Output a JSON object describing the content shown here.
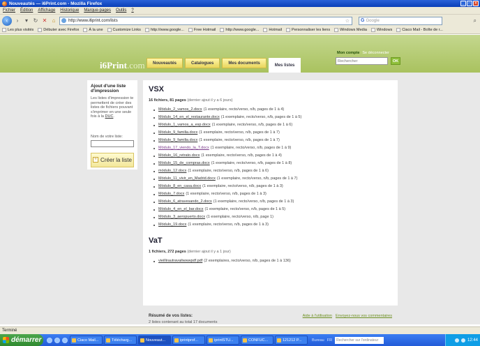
{
  "window": {
    "title": "Nouveautés — i6Print.com - Mozilla Firefox"
  },
  "menu": [
    "Fichier",
    "Édition",
    "Affichage",
    "Historique",
    "Marque-pages",
    "Outils",
    "?"
  ],
  "nav": {
    "url": "http://www.i6print.com/lists",
    "search_placeholder": "Google"
  },
  "bookmarks": [
    "Les plus visités",
    "Débuter avec Firefox",
    "À la une",
    "Customize Links",
    "http://www.google...",
    "Free Hotmail",
    "http://www.google...",
    "Hotmail",
    "Personnaliser les liens",
    "Windows Media",
    "Windows",
    "Ciaco Mail - Boîte de r..."
  ],
  "site": {
    "logo": "i6Print",
    "logo_suffix": ".com",
    "tabs": [
      "Nouveautés",
      "Catalogues",
      "Mes documents",
      "Mes listes"
    ],
    "account_link": "Mon compte",
    "logout_link": "Se déconnecter",
    "search_placeholder": "Rechercher",
    "ok_label": "OK"
  },
  "sidebar": {
    "title": "Ajout d'une liste d'impression",
    "desc": "Les listes d'impression te permettent de créer des listes de fichiers pouvant s'imprimer en une seule fois à la",
    "desc_link": "DUC",
    "name_label": "Nom de votre liste:",
    "create_label": "Créer la liste"
  },
  "lists": [
    {
      "title": "VSX",
      "count": "16 fichiers, 81 pages",
      "meta": "(dernier ajout il y a 6 jours)",
      "files": [
        {
          "name": "Módulo_2_vamos_2.docx",
          "info": "(1 exemplaire, recto/verso, n/b, pages de 1 à 4)"
        },
        {
          "name": "Módulo_14_en_el_restaurante.docx",
          "info": "(1 exemplaire, recto/verso, n/b, pages de 1 à 5)"
        },
        {
          "name": "Módulo_1_vamos_a_esp.docx",
          "info": "(1 exemplaire, recto/verso, n/b, pages de 1 à 6)"
        },
        {
          "name": "Módulo_9_familia.docx",
          "info": "(1 exemplaire, recto/verso, n/b, pages de 1 à 7)"
        },
        {
          "name": "Módulo_9_familia.docx",
          "info": "(1 exemplaire, recto/verso, n/b, pages de 1 à 7)"
        },
        {
          "name": "Módulo_17_viendo_la_T.docx",
          "info": "(1 exemplaire, recto/verso, n/b, pages de 1 à 9)"
        },
        {
          "name": "Módulo_16_retrato.docx",
          "info": "(1 exemplaire, recto/verso, n/b, pages de 1 à 4)"
        },
        {
          "name": "Módulo_15_de_compras.docx",
          "info": "(1 exemplaire, recto/verso, n/b, pages de 1 à 8)"
        },
        {
          "name": "módulo_12.docx",
          "info": "(1 exemplaire, recto/verso, n/b, pages de 1 à 6)"
        },
        {
          "name": "Módulo_11_vivir_en_Madrid.docx",
          "info": "(1 exemplaire, recto/verso, n/b, pages de 1 à 7)"
        },
        {
          "name": "Módulo_8_en_casa.docx",
          "info": "(1 exemplaire, recto/verso, n/b, pages de 1 à 3)"
        },
        {
          "name": "Módulo_7.docx",
          "info": "(1 exemplaire, recto/verso, n/b, pages de 1 à 3)"
        },
        {
          "name": "Módulo_6_atravesando_2.docx",
          "info": "(1 exemplaire, recto/verso, n/b, pages de 1 à 3)"
        },
        {
          "name": "Módulo_4_en_el_bar.docx",
          "info": "(1 exemplaire, recto/verso, n/b, pages de 1 à 5)"
        },
        {
          "name": "Módulo_3_aeropuerto.docx",
          "info": "(1 exemplaire, recto/verso, n/b, page 1)"
        },
        {
          "name": "Módulo_19.docx",
          "info": "(1 exemplaire, recto/verso, n/b, pages de 1 à 3)"
        }
      ]
    },
    {
      "title": "VaT",
      "count": "1 fichiers, 272 pages",
      "meta": "(dernier ajout il y a 1 jour)",
      "files": [
        {
          "name": "vieillirautravailwwwpdf.pdf",
          "info": "(2 exemplaires, recto/verso, n/b, pages de 1 à 136)"
        }
      ]
    }
  ],
  "footer": {
    "title": "Résumé de vos listes:",
    "text": "2 listes contenant au total 17 documents",
    "help_link": "Aide à l'utilisation",
    "comment_link": "Envoyez-nous vos commentaires"
  },
  "status": "Terminé",
  "taskbar": {
    "start": "démarrer",
    "tasks": [
      "Ciaco Mail...",
      "Télécharg...",
      "Nouveaut...",
      "iprintprof...",
      "iprintSTU...",
      "CONFUC...",
      "121212 P..."
    ],
    "bureau": "Bureau",
    "lang": "FR",
    "search_placeholder": "Rechercher sur l'ordinateur",
    "clock": "12:44"
  },
  "colors": {
    "accent_green": "#a9c25f",
    "tab_yellow": "#f3e17a",
    "xp_blue": "#225bd8"
  }
}
